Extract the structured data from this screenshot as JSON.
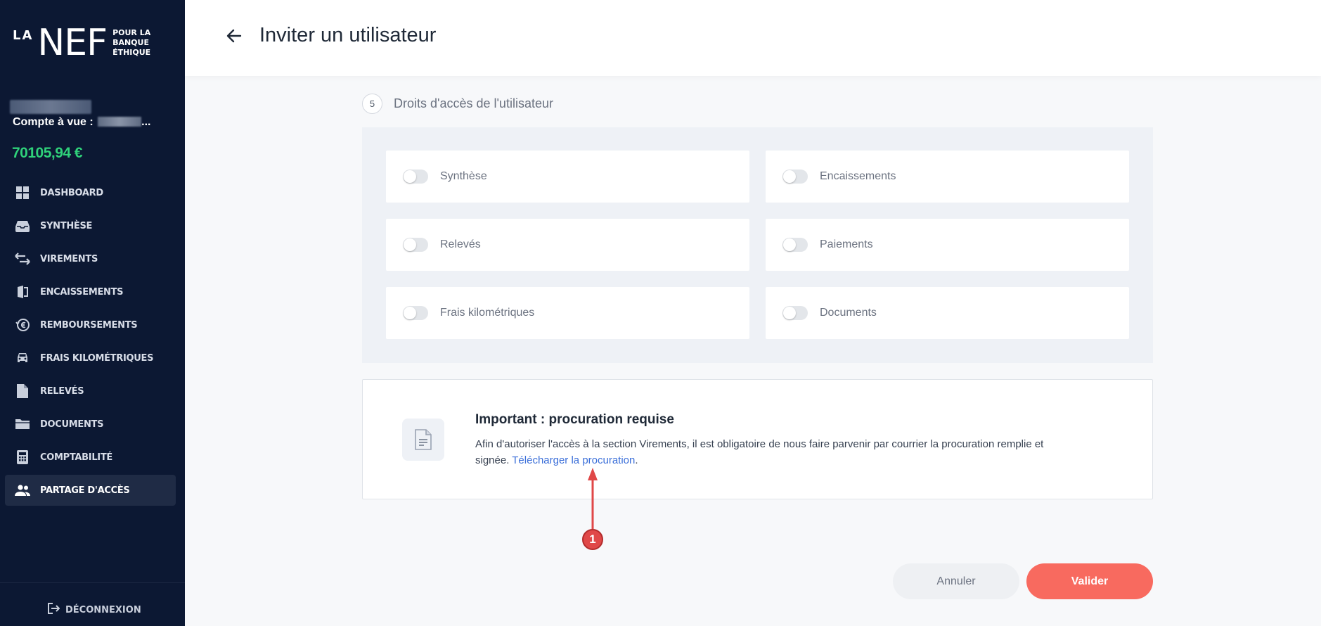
{
  "brand": {
    "la": "LA",
    "nef": "NEF",
    "tagline": [
      "POUR LA",
      "BANQUE",
      "ÉTHIQUE"
    ]
  },
  "account": {
    "label": "Compte à vue :",
    "suffix": "...",
    "balance": "70105,94 €"
  },
  "nav": [
    {
      "label": "DASHBOARD",
      "icon": "grid-icon"
    },
    {
      "label": "SYNTHÈSE",
      "icon": "inbox-icon"
    },
    {
      "label": "VIREMENTS",
      "icon": "transfer-icon"
    },
    {
      "label": "ENCAISSEMENTS",
      "icon": "cash-in-icon"
    },
    {
      "label": "REMBOURSEMENTS",
      "icon": "euro-refund-icon"
    },
    {
      "label": "FRAIS KILOMÉTRIQUES",
      "icon": "car-icon"
    },
    {
      "label": "RELEVÉS",
      "icon": "file-icon"
    },
    {
      "label": "DOCUMENTS",
      "icon": "folder-icon"
    },
    {
      "label": "COMPTABILITÉ",
      "icon": "calculator-icon"
    },
    {
      "label": "PARTAGE D'ACCÈS",
      "icon": "users-icon",
      "active": true
    }
  ],
  "logout": {
    "label": "DÉCONNEXION"
  },
  "header": {
    "title": "Inviter un utilisateur"
  },
  "step": {
    "number": "5",
    "title": "Droits d'accès de l'utilisateur"
  },
  "rights": [
    {
      "label": "Synthèse",
      "enabled": false
    },
    {
      "label": "Encaissements",
      "enabled": false
    },
    {
      "label": "Relevés",
      "enabled": false
    },
    {
      "label": "Paiements",
      "enabled": false
    },
    {
      "label": "Frais kilométriques",
      "enabled": false
    },
    {
      "label": "Documents",
      "enabled": false
    }
  ],
  "important": {
    "title": "Important : procuration requise",
    "text": "Afin d'autoriser l'accès à la section Virements, il est obligatoire de nous faire parvenir par courrier la procuration remplie et signée. ",
    "link": "Télécharger la procuration",
    "after_link": "."
  },
  "annotation": {
    "label": "1",
    "color": "#e04848"
  },
  "buttons": {
    "cancel": "Annuler",
    "submit": "Valider"
  },
  "colors": {
    "sidebar": "#0c1833",
    "balance": "#2fd17a",
    "accent": "#f86a5f",
    "link": "#3b6fd9"
  }
}
